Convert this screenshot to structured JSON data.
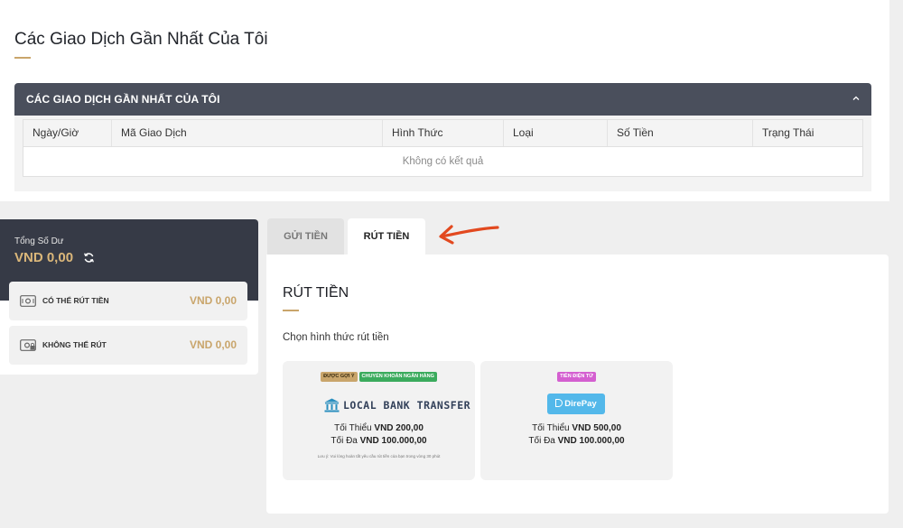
{
  "page": {
    "title": "Các Giao Dịch Gần Nhất Của Tôi",
    "accent_color": "#c9a56b",
    "dark_color": "#363a46"
  },
  "transactions": {
    "section_title": "CÁC GIAO DỊCH GẦN NHẤT CỦA TÔI",
    "toggle_icon": "chevron-up-icon",
    "columns": [
      "Ngày/Giờ",
      "Mã Giao Dịch",
      "Hình Thức",
      "Loại",
      "Số Tiền",
      "Trạng Thái"
    ],
    "empty_text": "Không có kết quả"
  },
  "balance": {
    "label": "Tổng Số Dư",
    "amount": "VND 0,00",
    "refresh_icon": "refresh-icon",
    "wallets": [
      {
        "name": "CÓ THỂ RÚT TIỀN",
        "amount": "VND 0,00",
        "icon": "cash-icon"
      },
      {
        "name": "KHÔNG THỂ RÚT",
        "amount": "VND 0,00",
        "icon": "locked-cash-icon"
      }
    ]
  },
  "tabs": [
    {
      "label": "GỬI TIỀN",
      "active": false
    },
    {
      "label": "RÚT TIỀN",
      "active": true
    }
  ],
  "annotation": {
    "icon": "red-arrow-icon",
    "color": "#e2491f"
  },
  "withdraw": {
    "title": "RÚT TIỀN",
    "subtitle": "Chọn hình thức rút tiền",
    "methods": [
      {
        "badges": [
          "ĐƯỢC GỢI Ý",
          "CHUYỂN KHOẢN NGÂN HÀNG"
        ],
        "logo_text": "LOCAL BANK TRANSFER",
        "min_label": "Tối Thiểu",
        "min_value": "VND 200,00",
        "max_label": "Tối Đa",
        "max_value": "VND 100.000,00",
        "note": "Lưu ý: Vui lòng hoàn tất yêu cầu rút tiền của bạn trong vòng 30 phút"
      },
      {
        "badges": [
          "TIỀN ĐIỆN TỬ"
        ],
        "logo_text": "DirePay",
        "min_label": "Tối Thiểu",
        "min_value": "VND 500,00",
        "max_label": "Tối Đa",
        "max_value": "VND 100.000,00"
      }
    ]
  }
}
